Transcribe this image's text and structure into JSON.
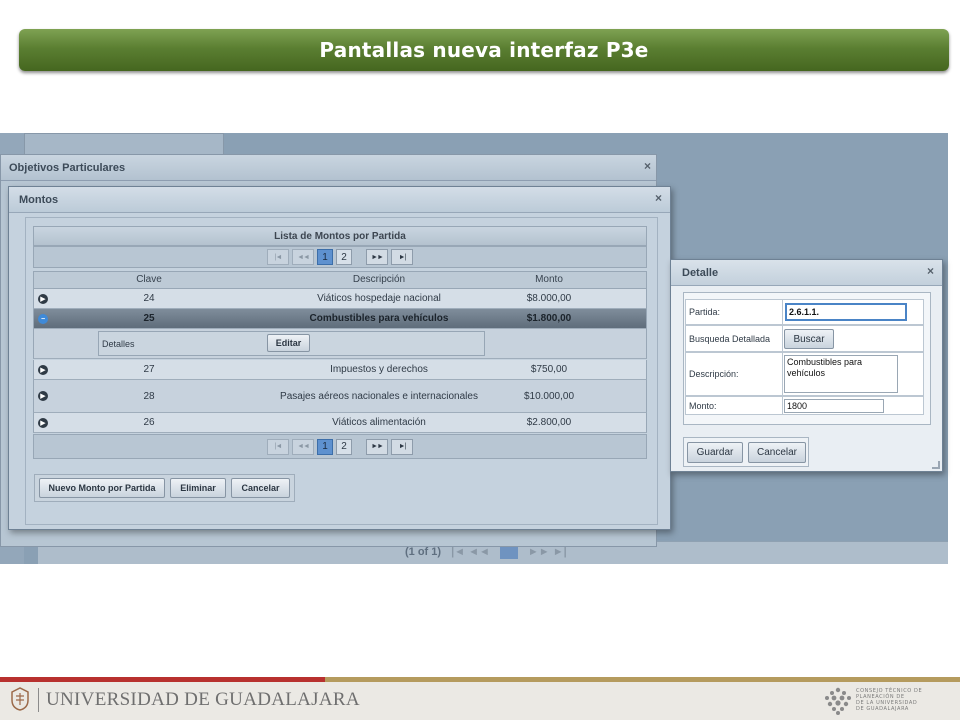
{
  "slide": {
    "title": "Pantallas nueva interfaz P3e"
  },
  "background": {
    "pager_text": "(1 of 1)",
    "pager_page": "1"
  },
  "objetivos_dialog": {
    "title": "Objetivos Particulares",
    "close": "×"
  },
  "montos_dialog": {
    "title": "Montos",
    "close": "×",
    "list_title": "Lista de Montos por Partida",
    "pager": {
      "first": "|◄",
      "prev": "◄◄",
      "pages": [
        "1",
        "2"
      ],
      "next": "►►",
      "last": "►|"
    },
    "columns": {
      "clave": "Clave",
      "descripcion": "Descripción",
      "monto": "Monto"
    },
    "rows": [
      {
        "clave": "24",
        "descripcion": "Viáticos hospedaje nacional",
        "monto": "$8.000,00"
      },
      {
        "clave": "25",
        "descripcion": "Combustibles para vehículos",
        "monto": "$1.800,00"
      },
      {
        "clave": "27",
        "descripcion": "Impuestos y derechos",
        "monto": "$750,00"
      },
      {
        "clave": "28",
        "descripcion": "Pasajes aéreos nacionales e internacionales",
        "monto": "$10.000,00"
      },
      {
        "clave": "26",
        "descripcion": "Viáticos alimentación",
        "monto": "$2.800,00"
      }
    ],
    "detail": {
      "label": "Detalles",
      "edit_button": "Editar"
    },
    "buttons": {
      "nuevo": "Nuevo Monto por Partida",
      "eliminar": "Eliminar",
      "cancelar": "Cancelar"
    }
  },
  "detalle_dialog": {
    "title": "Detalle",
    "close": "×",
    "fields": {
      "partida_label": "Partida:",
      "partida_value": "2.6.1.1.",
      "busqueda_label": "Busqueda Detallada",
      "buscar_button": "Buscar",
      "descripcion_label": "Descripción:",
      "descripcion_value": "Combustibles para vehículos",
      "monto_label": "Monto:",
      "monto_value": "1800"
    },
    "buttons": {
      "guardar": "Guardar",
      "cancelar": "Cancelar"
    }
  },
  "footer": {
    "university": "UNIVERSIDAD DE GUADALAJARA",
    "ctp_lines": [
      "CONSEJO TÉCNICO DE",
      "PLANEACIÓN DE",
      "DE LA UNIVERSIDAD",
      "DE GUADALAJARA"
    ]
  },
  "colors": {
    "banner_green": "#5b7f32",
    "footer_red": "#b8312f",
    "footer_gold": "#b59b5e",
    "active_page_blue": "#5e91cf"
  }
}
